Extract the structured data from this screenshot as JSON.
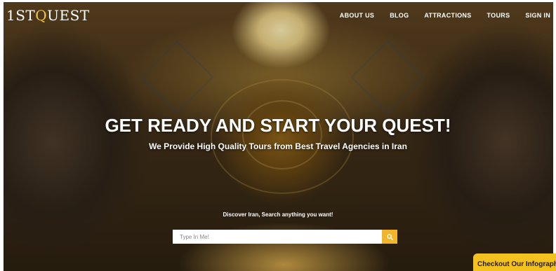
{
  "header": {
    "logo_prefix": "1ST",
    "logo_q": "Q",
    "logo_suffix": "UEST"
  },
  "nav": {
    "items": [
      {
        "label": "ABOUT US"
      },
      {
        "label": "BLOG"
      },
      {
        "label": "ATTRACTIONS"
      },
      {
        "label": "TOURS"
      },
      {
        "label": "SIGN IN"
      }
    ]
  },
  "hero": {
    "headline": "GET READY AND START YOUR QUEST!",
    "subheadline": "We Provide High Quality Tours from Best Travel Agencies in Iran",
    "search_prompt": "Discover Iran, Search anything you want!"
  },
  "search": {
    "placeholder": "Type In Me!",
    "button_icon": "search-icon",
    "accent_color": "#f0b52a"
  },
  "infographic_tab": {
    "label": "Checkout Our Infographic",
    "color": "#f4c21f"
  }
}
